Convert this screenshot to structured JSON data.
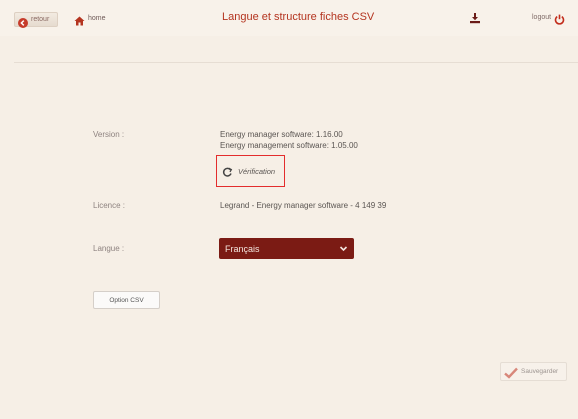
{
  "header": {
    "back_label": "retour",
    "home_label": "home",
    "title": "Langue et structure fiches CSV",
    "logout_label": "logout"
  },
  "info": {
    "version_label": "Version :",
    "version_line1": "Energy manager software: 1.16.00",
    "version_line2": "Energy management software: 1.05.00",
    "verify_label": "Vérification",
    "licence_label": "Licence :",
    "licence_value": "Legrand - Energy manager software - 4 149 39",
    "language_label": "Langue :",
    "language_selected": "Français"
  },
  "buttons": {
    "csv_option": "Option CSV",
    "save": "Sauvegarder"
  },
  "colors": {
    "accent": "#b4341f",
    "select_bg": "#7b1b14",
    "highlight_border": "#e32d2d",
    "background": "#f6efe6"
  },
  "icons": [
    "back-arrow-icon",
    "home-icon",
    "download-icon",
    "power-icon",
    "refresh-icon",
    "chevron-down-icon",
    "checkmark-icon"
  ]
}
